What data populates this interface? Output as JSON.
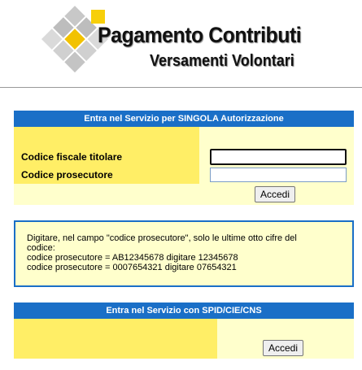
{
  "header": {
    "title": "Pagamento Contributi",
    "subtitle": "Versamenti Volontari"
  },
  "panel1": {
    "heading": "Entra nel Servizio per SINGOLA Autorizzazione",
    "codice_fiscale_label": "Codice fiscale titolare",
    "codice_fiscale_value": "",
    "codice_prosecutore_label": "Codice prosecutore",
    "codice_prosecutore_value": "",
    "submit_label": "Accedi"
  },
  "info": {
    "line1": "Digitare, nel campo \"codice prosecutore\", solo le ultime otto cifre del",
    "line2": "codice:",
    "line3": "codice prosecutore = AB12345678 digitare 12345678",
    "line4": "codice prosecutore = 0007654321 digitare 07654321"
  },
  "panel2": {
    "heading": "Entra nel Servizio con SPID/CIE/CNS",
    "submit_label": "Accedi"
  },
  "colors": {
    "header_blue": "#1a6fc7",
    "label_yellow": "#ffee66",
    "row_pale_yellow": "#ffffcc"
  }
}
